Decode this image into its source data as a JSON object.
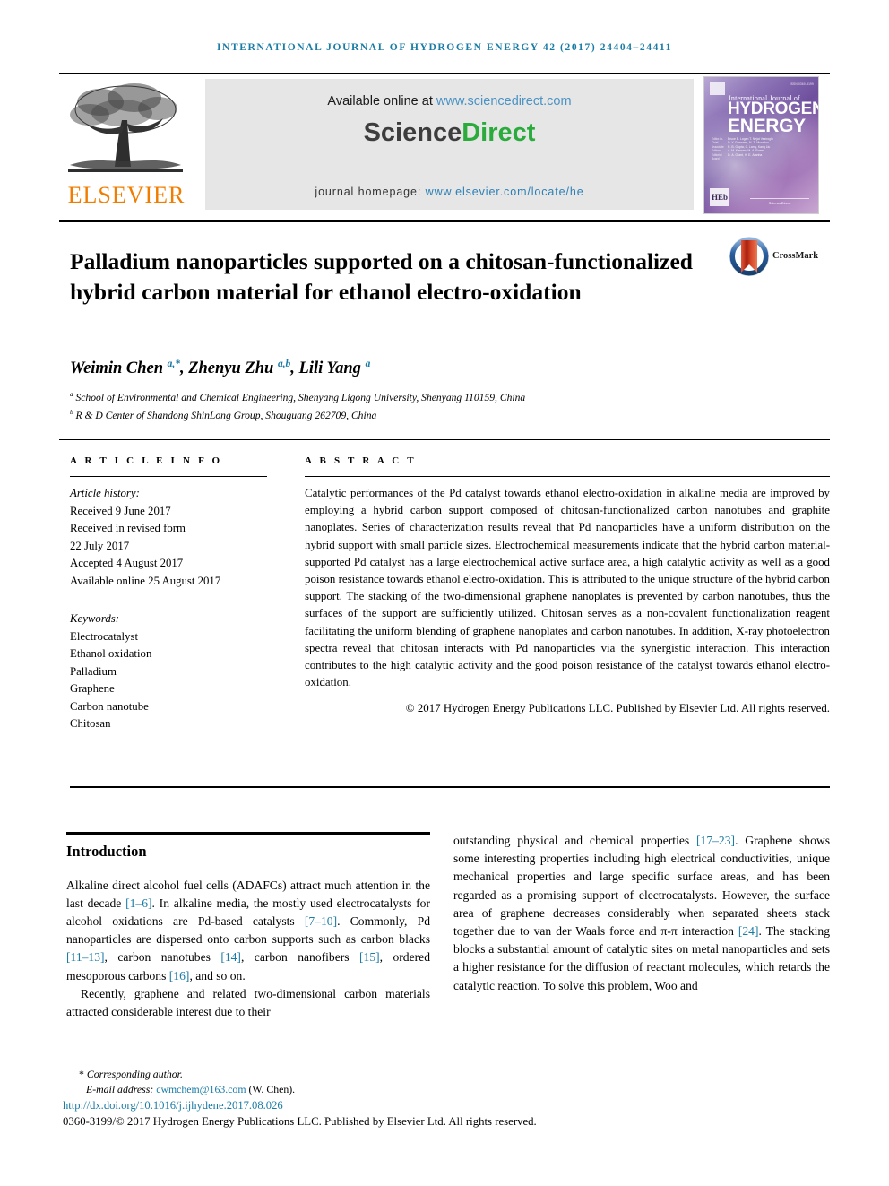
{
  "running_head": "INTERNATIONAL JOURNAL OF HYDROGEN ENERGY 42 (2017) 24404–24411",
  "masthead": {
    "elsevier_wordmark": "ELSEVIER",
    "available_prefix": "Available online at ",
    "available_link": "www.sciencedirect.com",
    "sciencedirect_science": "Science",
    "sciencedirect_direct": "Direct",
    "homepage_prefix": "journal homepage: ",
    "homepage_link": "www.elsevier.com/locate/he",
    "colors": {
      "elsevier_orange": "#f07d00",
      "sciencedirect_green": "#2aab3c",
      "link_blue": "#2b7fb5",
      "band_gray": "#e6e6e6"
    }
  },
  "cover": {
    "issn": "ISSN 0360-3199",
    "line_ij": "International Journal of",
    "line_hydrogen": "HYDROGEN",
    "line_energy": "ENERGY",
    "label_editors": "Editor-in-Chief\nAssociate Editors\nEditorial Board",
    "editors": "Bruce E. Logan   T. Nejat Veziroglu\nD. Y. Goswami, N. Z. Muradov\nR. B. Gupta, C. Lamy, Kang Liu\nA. M. Kannan, M. A. Rosen\nD. A. Grant, H. E. Aranha",
    "publisher_mark": "HEb",
    "publisher_name": "ScienceDirect"
  },
  "title": "Palladium nanoparticles supported on a chitosan-functionalized hybrid carbon material for ethanol electro-oxidation",
  "crossmark": {
    "label": "CrossMark",
    "ring_color": "#2b5f9e",
    "mark_color": "#c03118"
  },
  "authors": {
    "a1_name": "Weimin Chen ",
    "a1_sup": "a,*",
    "sep1": ", ",
    "a2_name": "Zhenyu Zhu ",
    "a2_sup": "a,b",
    "sep2": ", ",
    "a3_name": "Lili Yang ",
    "a3_sup": "a"
  },
  "affiliations": [
    {
      "marker": "a",
      "text": " School of Environmental and Chemical Engineering, Shenyang Ligong University, Shenyang 110159, China"
    },
    {
      "marker": "b",
      "text": " R & D Center of Shandong ShinLong Group, Shouguang 262709, China"
    }
  ],
  "article_info": {
    "heading": "A R T I C L E   I N F O",
    "history_label": "Article history:",
    "history": [
      "Received 9 June 2017",
      "Received in revised form",
      "22 July 2017",
      "Accepted 4 August 2017",
      "Available online 25 August 2017"
    ],
    "keywords_label": "Keywords:",
    "keywords": [
      "Electrocatalyst",
      "Ethanol oxidation",
      "Palladium",
      "Graphene",
      "Carbon nanotube",
      "Chitosan"
    ]
  },
  "abstract": {
    "heading": "A B S T R A C T",
    "text": "Catalytic performances of the Pd catalyst towards ethanol electro-oxidation in alkaline media are improved by employing a hybrid carbon support composed of chitosan-functionalized carbon nanotubes and graphite nanoplates. Series of characterization results reveal that Pd nanoparticles have a uniform distribution on the hybrid support with small particle sizes. Electrochemical measurements indicate that the hybrid carbon material-supported Pd catalyst has a large electrochemical active surface area, a high catalytic activity as well as a good poison resistance towards ethanol electro-oxidation. This is attributed to the unique structure of the hybrid carbon support. The stacking of the two-dimensional graphene nanoplates is prevented by carbon nanotubes, thus the surfaces of the support are sufficiently utilized. Chitosan serves as a non-covalent functionalization reagent facilitating the uniform blending of graphene nanoplates and carbon nanotubes. In addition, X-ray photoelectron spectra reveal that chitosan interacts with Pd nanoparticles via the synergistic interaction. This interaction contributes to the high catalytic activity and the good poison resistance of the catalyst towards ethanol electro-oxidation.",
    "copyright": "© 2017 Hydrogen Energy Publications LLC. Published by Elsevier Ltd. All rights reserved."
  },
  "introduction": {
    "heading": "Introduction",
    "left_p1_a": "Alkaline direct alcohol fuel cells (ADAFCs) attract much attention in the last decade ",
    "left_p1_r1": "[1–6]",
    "left_p1_b": ". In alkaline media, the mostly used electrocatalysts for alcohol oxidations are Pd-based catalysts ",
    "left_p1_r2": "[7–10]",
    "left_p1_c": ". Commonly, Pd nanoparticles are dispersed onto carbon supports such as carbon blacks ",
    "left_p1_r3": "[11–13]",
    "left_p1_d": ", carbon nanotubes ",
    "left_p1_r4": "[14]",
    "left_p1_e": ", carbon nanofibers ",
    "left_p1_r5": "[15]",
    "left_p1_f": ", ordered mesoporous carbons ",
    "left_p1_r6": "[16]",
    "left_p1_g": ", and so on.",
    "left_p2": "Recently, graphene and related two-dimensional carbon materials attracted considerable interest due to their",
    "right_p1_a": "outstanding physical and chemical properties ",
    "right_p1_r1": "[17–23]",
    "right_p1_b": ". Graphene shows some interesting properties including high electrical conductivities, unique mechanical properties and large specific surface areas, and has been regarded as a promising support of electrocatalysts. However, the surface area of graphene decreases considerably when separated sheets stack together due to van der Waals force and π-π interaction ",
    "right_p1_r2": "[24]",
    "right_p1_c": ". The stacking blocks a substantial amount of catalytic sites on metal nanoparticles and sets a higher resistance for the diffusion of reactant molecules, which retards the catalytic reaction. To solve this problem, Woo and"
  },
  "footer": {
    "corresponding_marker": "*",
    "corresponding_text": " Corresponding author.",
    "email_label": "E-mail address: ",
    "email": "cwmchem@163.com",
    "email_suffix": " (W. Chen).",
    "doi": "http://dx.doi.org/10.1016/j.ijhydene.2017.08.026",
    "issn_line": "0360-3199/© 2017 Hydrogen Energy Publications LLC. Published by Elsevier Ltd. All rights reserved."
  }
}
